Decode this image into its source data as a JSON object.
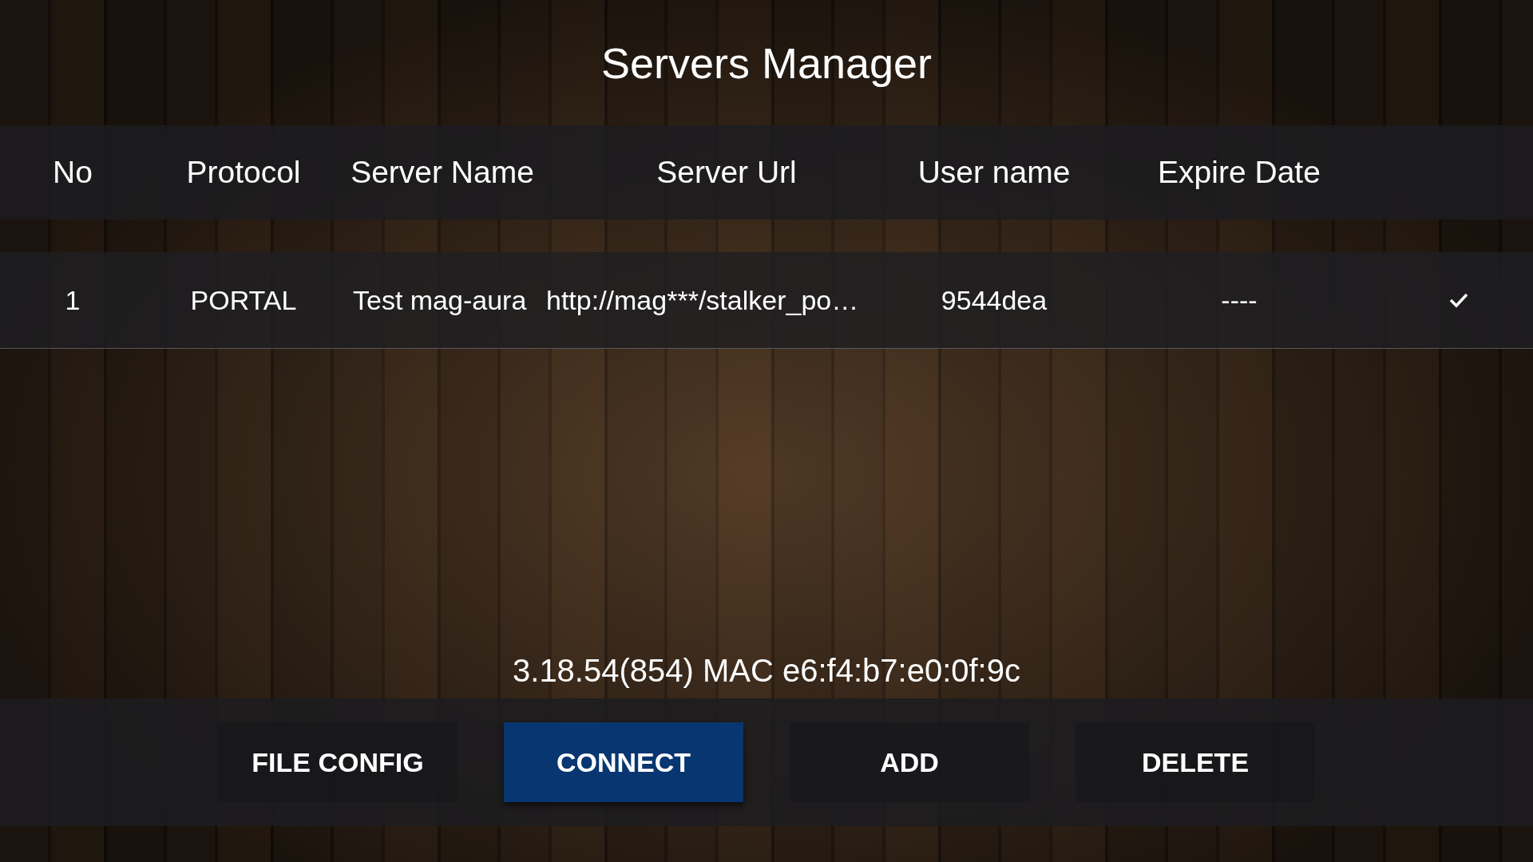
{
  "title": "Servers Manager",
  "table": {
    "columns": [
      "No",
      "Protocol",
      "Server Name",
      "Server Url",
      "User name",
      "Expire Date"
    ],
    "rows": [
      {
        "no": "1",
        "protocol": "PORTAL",
        "server_name": "Test mag-aura",
        "server_url": "http://mag***/stalker_po…",
        "user_name": "9544dea",
        "expire_date": "----",
        "selected": true
      }
    ]
  },
  "version_info": "3.18.54(854) MAC e6:f4:b7:e0:0f:9c",
  "buttons": [
    {
      "label": "FILE CONFIG",
      "selected": false
    },
    {
      "label": "CONNECT",
      "selected": true
    },
    {
      "label": "ADD",
      "selected": false
    },
    {
      "label": "DELETE",
      "selected": false
    }
  ]
}
